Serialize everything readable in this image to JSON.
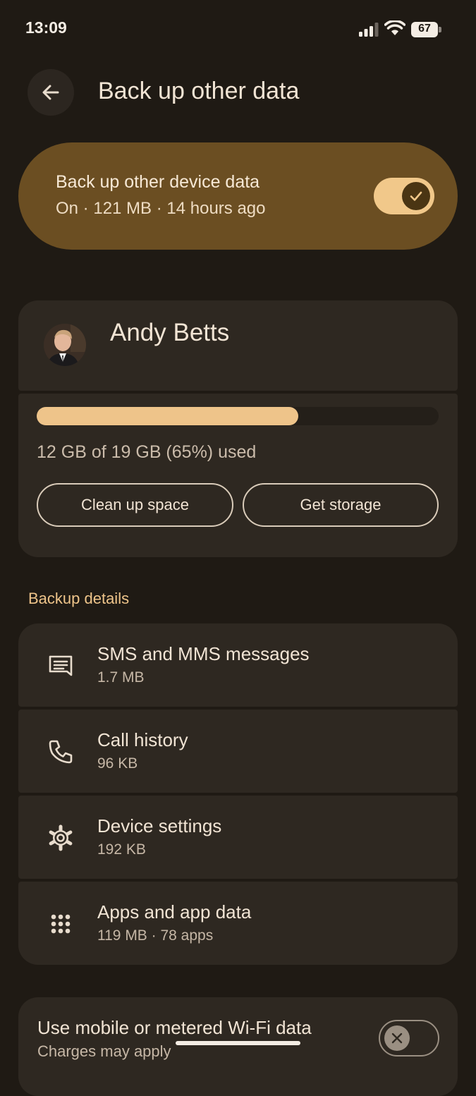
{
  "status_bar": {
    "time": "13:09",
    "battery": "67"
  },
  "header": {
    "title": "Back up other data",
    "back_icon": "arrow-back-icon"
  },
  "backup_toggle": {
    "title": "Back up other device data",
    "subtitle": "On · 121 MB · 14 hours ago",
    "enabled": true,
    "accent": "#6b4e22"
  },
  "account": {
    "name": "Andy Betts"
  },
  "storage": {
    "used_fraction": 0.65,
    "text": "12 GB of 19 GB (65%) used",
    "clean_up_label": "Clean up space",
    "get_storage_label": "Get storage",
    "bar_color": "#eec48a"
  },
  "backup_details": {
    "header": "Backup details",
    "items": [
      {
        "title": "SMS and MMS messages",
        "subtitle": "1.7 MB",
        "icon": "message-icon"
      },
      {
        "title": "Call history",
        "subtitle": "96 KB",
        "icon": "phone-icon"
      },
      {
        "title": "Device settings",
        "subtitle": "192 KB",
        "icon": "gear-icon"
      },
      {
        "title": "Apps and app data",
        "subtitle": "119 MB · 78 apps",
        "icon": "apps-grid-icon"
      }
    ]
  },
  "mobile_data": {
    "title": "Use mobile or metered Wi-Fi data",
    "subtitle": "Charges may apply",
    "enabled": false
  }
}
